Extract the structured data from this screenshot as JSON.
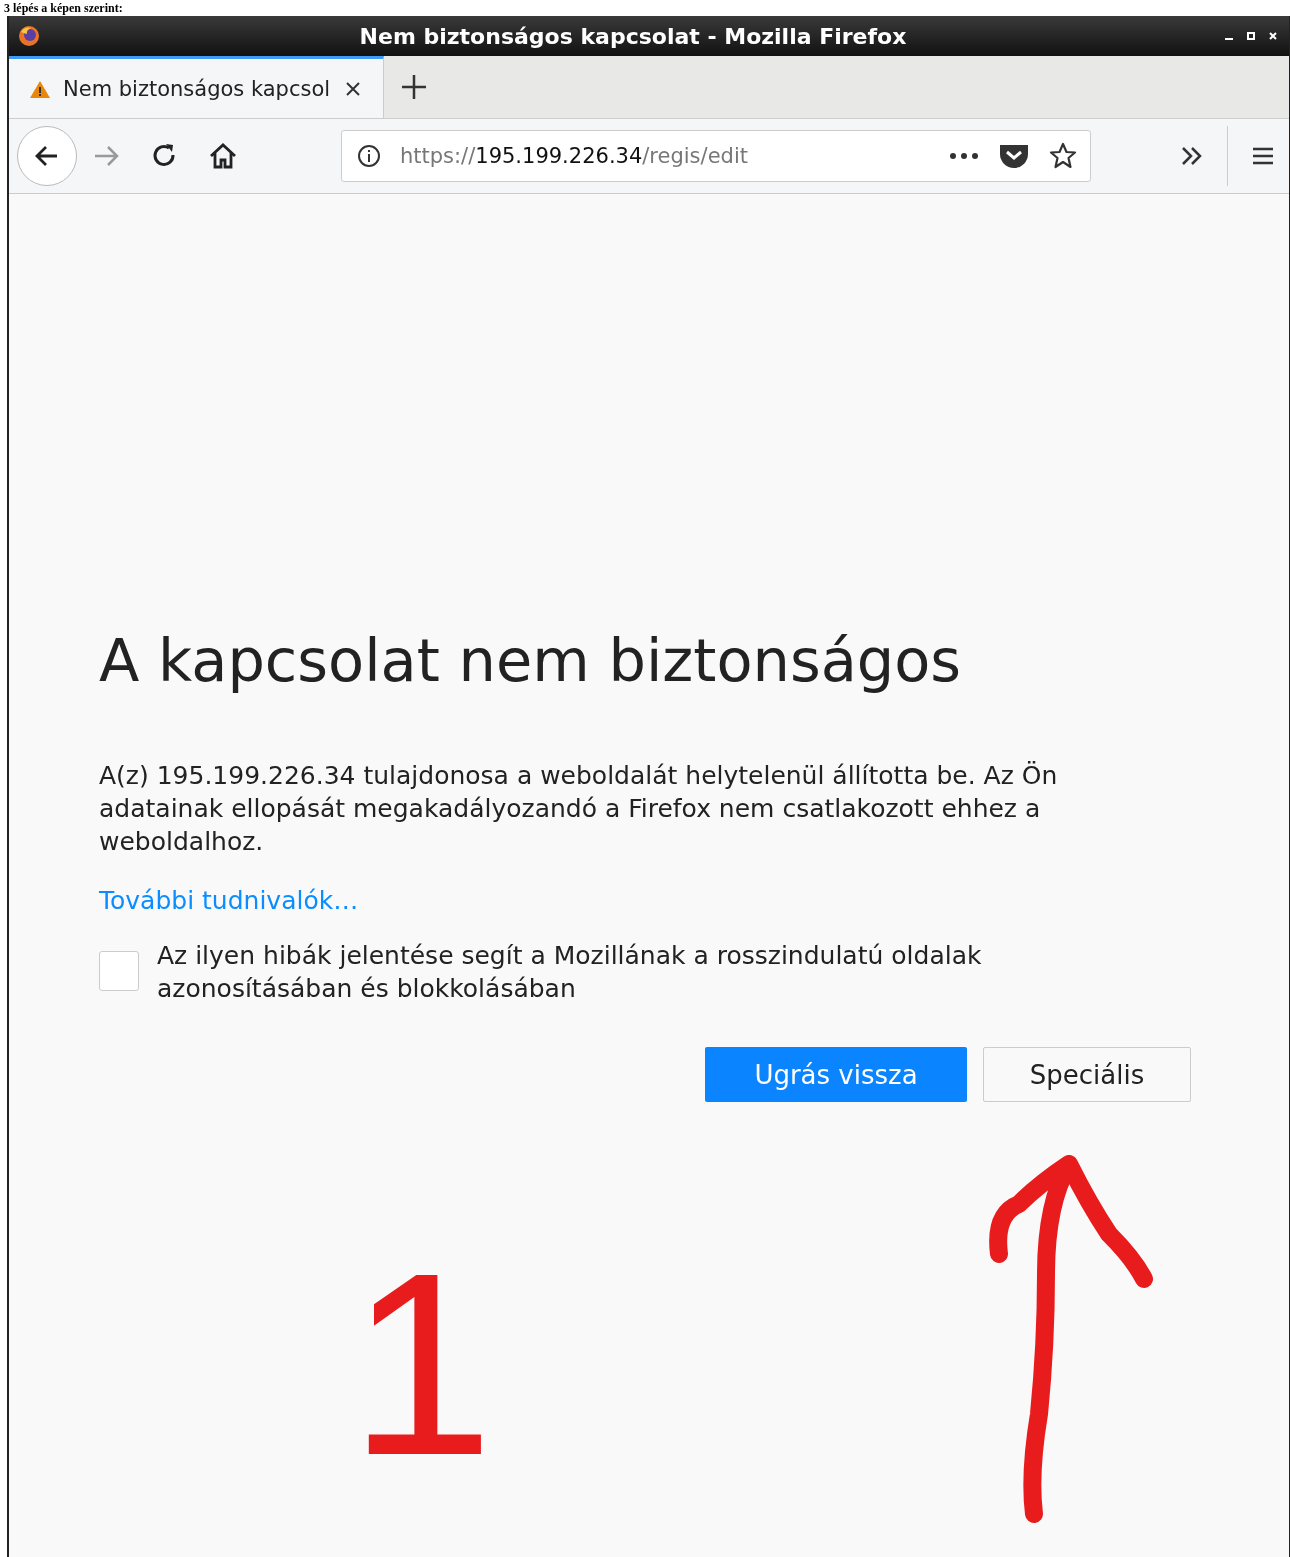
{
  "caption": "3 lépés a képen szerint:",
  "window": {
    "title": "Nem biztonságos kapcsolat - Mozilla Firefox"
  },
  "tabs": [
    {
      "label": "Nem biztonságos kapcsol",
      "selected": true
    }
  ],
  "address_bar": {
    "scheme": "https://",
    "host": "195.199.226.34",
    "path": "/regis/edit"
  },
  "error_page": {
    "heading": "A kapcsolat nem biztonságos",
    "message": "A(z) 195.199.226.34 tulajdonosa a weboldalát helytelenül állította be. Az Ön adatainak ellopását megakadályozandó a Firefox nem csatlakozott ehhez a weboldalhoz.",
    "link": "További tudnivalók…",
    "report": {
      "label": "Az ilyen hibák jelentése segít a Mozillának a rosszindulatú oldalak azonosításában és blokkolásában",
      "checked": false
    },
    "buttons": [
      {
        "label": "Ugrás vissza",
        "kind": "primary"
      },
      {
        "label": "Speciális",
        "kind": "secondary"
      }
    ]
  },
  "annotation": {
    "number": "1"
  }
}
